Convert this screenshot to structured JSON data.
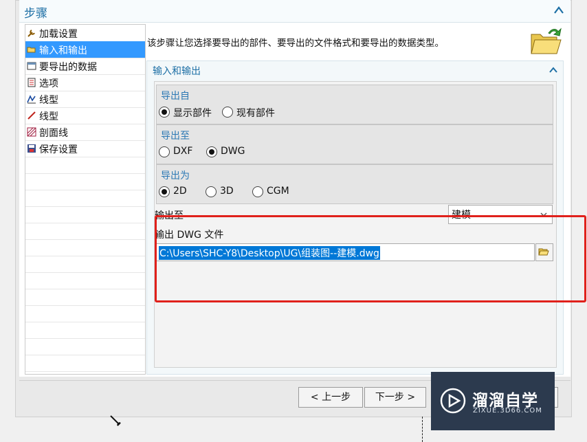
{
  "header": {
    "title": "步骤",
    "collapse_icon": "chevron-up-icon"
  },
  "steps": [
    {
      "label": "加载设置",
      "icon": "wrench-icon",
      "selected": false
    },
    {
      "label": "输入和输出",
      "icon": "folder-open-icon",
      "selected": true
    },
    {
      "label": "要导出的数据",
      "icon": "window-icon",
      "selected": false
    },
    {
      "label": "选项",
      "icon": "checklist-icon",
      "selected": false
    },
    {
      "label": "线型",
      "icon": "linetype-icon",
      "selected": false
    },
    {
      "label": "线型",
      "icon": "line-icon",
      "selected": false
    },
    {
      "label": "剖面线",
      "icon": "hatch-icon",
      "selected": false
    },
    {
      "label": "保存设置",
      "icon": "save-icon",
      "selected": false
    }
  ],
  "description": "该步骤让您选择要导出的部件、要导出的文件格式和要导出的数据类型。",
  "section": {
    "title": "输入和输出",
    "export_from": {
      "label": "导出自",
      "options": [
        "显示部件",
        "现有部件"
      ],
      "selected": "显示部件"
    },
    "export_to": {
      "label": "导出至",
      "options": [
        "DXF",
        "DWG"
      ],
      "selected": "DWG"
    },
    "export_as": {
      "label": "导出为",
      "options": [
        "2D",
        "3D",
        "CGM"
      ],
      "selected": "2D"
    },
    "output_to": {
      "label": "输出至",
      "value": "建模"
    },
    "output_file": {
      "label": "输出 DWG 文件",
      "value": "C:\\Users\\SHC-Y8\\Desktop\\UG\\组装图--建模.dwg"
    }
  },
  "buttons": {
    "back": "< 上一步",
    "next": "下一步 >"
  },
  "watermark": {
    "name": "溜溜自学",
    "url": "ZIXUE.3D66.COM"
  },
  "colors": {
    "accent": "#1d6fa5",
    "selection": "#3399ff",
    "highlight_box": "#e0201b"
  }
}
